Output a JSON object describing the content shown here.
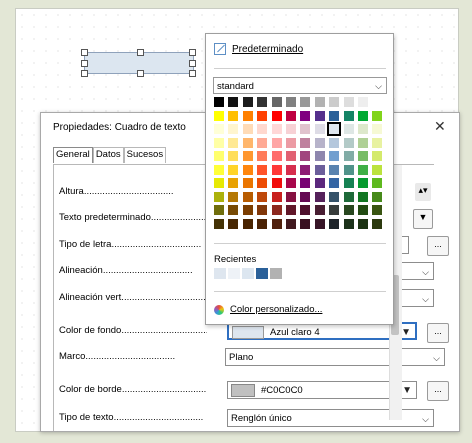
{
  "dialog": {
    "title": "Propiedades: Cuadro de texto",
    "close": "✕",
    "tabs": [
      "General",
      "Datos",
      "Sucesos"
    ],
    "rows": [
      {
        "label": "Altura",
        "value": ""
      },
      {
        "label": "Texto predeterminado",
        "value": ""
      },
      {
        "label": "Tipo de letra",
        "value": ""
      },
      {
        "label": "Alineación",
        "value": ""
      },
      {
        "label": "Alineación vert.",
        "value": ""
      },
      {
        "label": "Color de fondo",
        "value": "Azul claro 4"
      },
      {
        "label": "Marco",
        "value": "Plano"
      },
      {
        "label": "Color de borde",
        "value": "#C0C0C0"
      },
      {
        "label": "Tipo de texto",
        "value": "Renglón único"
      }
    ],
    "more_button": "..."
  },
  "popup": {
    "default_label": "Predeterminado",
    "palette_name": "standard",
    "recent_label": "Recientes",
    "custom_label": "Color personalizado...",
    "palette_rows": [
      [
        "#000000",
        "#111111",
        "#1c1c1c",
        "#333333",
        "#666666",
        "#808080",
        "#999999",
        "#b2b2b2",
        "#cccccc",
        "#dddddd",
        "#eeeeee",
        "#ffffff"
      ],
      [
        "#ffff00",
        "#ffbf00",
        "#ff8000",
        "#ff4000",
        "#ff0000",
        "#bf0041",
        "#800080",
        "#55308d",
        "#2a6099",
        "#158466",
        "#00a933",
        "#81d41a"
      ],
      [
        "#ffffd7",
        "#fff5ce",
        "#ffdbb6",
        "#ffd8ce",
        "#ffd7d7",
        "#f7d1d5",
        "#e0c2cd",
        "#dedce6",
        "#dee6ef",
        "#dee7e5",
        "#dde8cb",
        "#f6f9d4"
      ],
      [
        "#ffffa6",
        "#ffe994",
        "#ffb66c",
        "#ffaa95",
        "#ffa6a6",
        "#ec9ba4",
        "#bf819e",
        "#b7b3ca",
        "#b4c7dc",
        "#b3cac7",
        "#afd095",
        "#e8f2a1"
      ],
      [
        "#ffff6d",
        "#ffde59",
        "#ff972f",
        "#ff7b59",
        "#ff6d6d",
        "#e16173",
        "#a1467e",
        "#8e86ae",
        "#729fcf",
        "#81aca6",
        "#77bc65",
        "#d4ea6b"
      ],
      [
        "#ffff38",
        "#ffd428",
        "#ff860d",
        "#ff5429",
        "#ff3838",
        "#d62e4e",
        "#8d1d75",
        "#6b5e9b",
        "#5983b0",
        "#50938a",
        "#3faf46",
        "#bbe33d"
      ],
      [
        "#e6e905",
        "#e8a202",
        "#ea7500",
        "#ed4c05",
        "#f10d0c",
        "#a7074b",
        "#780373",
        "#5b277d",
        "#3465a4",
        "#168253",
        "#069a2e",
        "#5eb91e"
      ],
      [
        "#acb20c",
        "#b47804",
        "#b85c00",
        "#be480a",
        "#c9211e",
        "#861141",
        "#650953",
        "#55215b",
        "#355269",
        "#1e6a39",
        "#127622",
        "#468a1a"
      ],
      [
        "#706e0c",
        "#784b04",
        "#7b3d00",
        "#813709",
        "#8d281e",
        "#611729",
        "#4e102d",
        "#481d32",
        "#383d3c",
        "#28471f",
        "#224b12",
        "#395511"
      ],
      [
        "#443205",
        "#472702",
        "#492300",
        "#4b2204",
        "#50200c",
        "#41191f",
        "#3a1021",
        "#371527",
        "#1d2329",
        "#1c321a",
        "#1c3312",
        "#2c3a0e"
      ]
    ],
    "recent_colors": [
      "#dee6ef",
      "#eef2f7",
      "#dce6f0",
      "#2a6099",
      "#b2b2b2"
    ],
    "selected_cell": "Azul claro 4"
  }
}
